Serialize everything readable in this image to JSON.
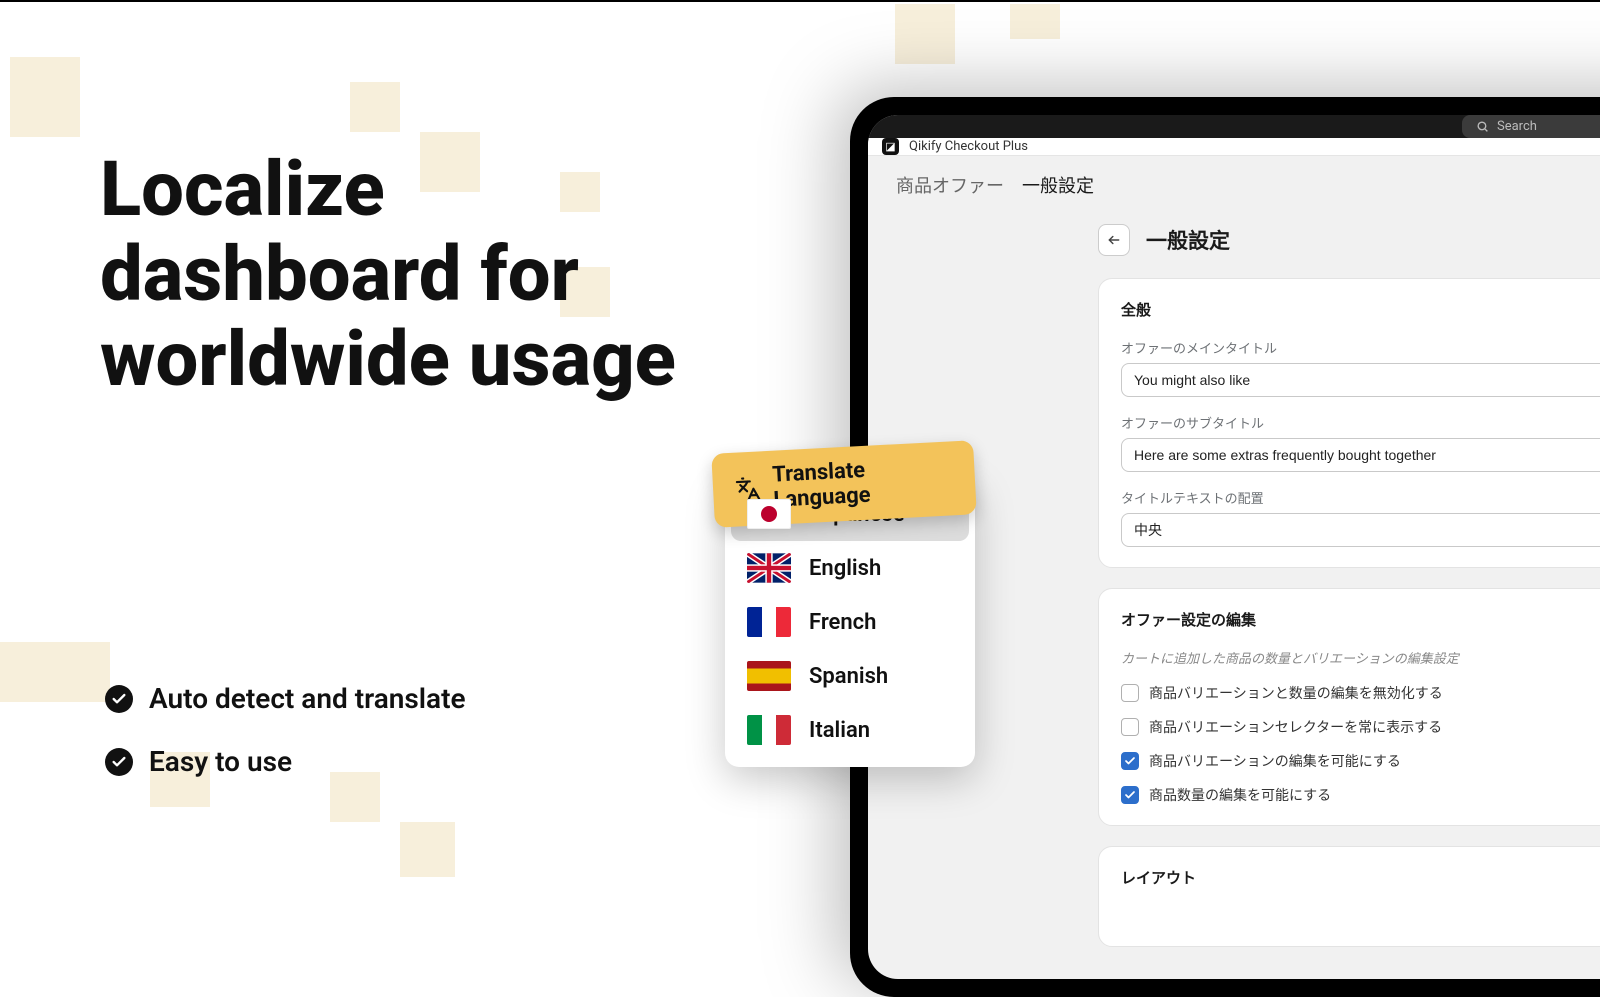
{
  "marketing": {
    "headline_l1": "Localize",
    "headline_l2": "dashboard for",
    "headline_l3": "worldwide usage",
    "feature1": "Auto detect and translate",
    "feature2": "Easy to use"
  },
  "translate_badge": "Translate Language",
  "languages": [
    {
      "code": "jp",
      "label": "Japanese",
      "selected": true
    },
    {
      "code": "uk",
      "label": "English",
      "selected": false
    },
    {
      "code": "fr",
      "label": "French",
      "selected": false
    },
    {
      "code": "es",
      "label": "Spanish",
      "selected": false
    },
    {
      "code": "it",
      "label": "Italian",
      "selected": false
    }
  ],
  "tablet": {
    "search_placeholder": "Search",
    "app_name": "Qikify Checkout Plus",
    "breadcrumb1": "商品オファー",
    "breadcrumb2": "一般設定",
    "page_title": "一般設定",
    "card_general": {
      "title": "全般",
      "main_title_label": "オファーのメインタイトル",
      "main_title_value": "You might also like",
      "sub_title_label": "オファーのサブタイトル",
      "sub_title_value": "Here are some extras frequently bought together",
      "title_align_label": "タイトルテキストの配置",
      "title_align_value": "中央"
    },
    "card_edit": {
      "title": "オファー設定の編集",
      "subtitle": "カートに追加した商品の数量とバリエーションの編集設定",
      "opt1": "商品バリエーションと数量の編集を無効化する",
      "opt2": "商品バリエーションセレクターを常に表示する",
      "opt3": "商品バリエーションの編集を可能にする",
      "opt4": "商品数量の編集を可能にする"
    },
    "card_layout_title": "レイアウト"
  }
}
